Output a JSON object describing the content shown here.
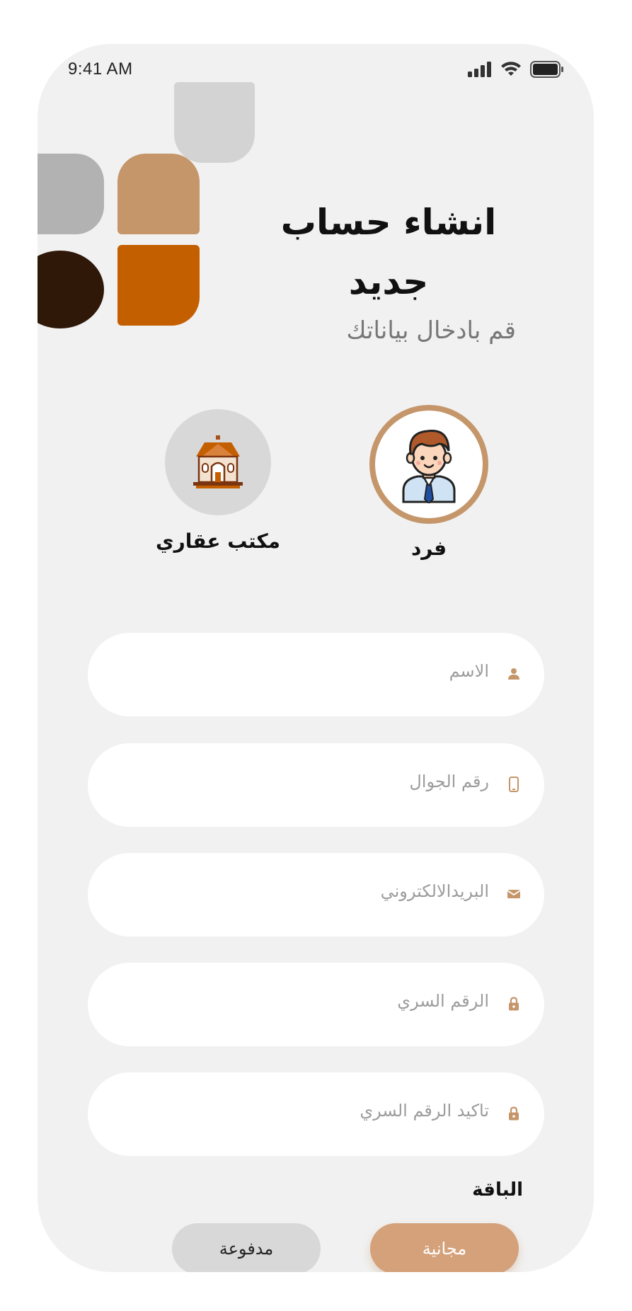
{
  "status_bar": {
    "time": "9:41 AM"
  },
  "header": {
    "title": "انشاء حساب جديد",
    "subtitle": "قم بادخال بياناتك"
  },
  "account_types": [
    {
      "label": "فرد",
      "icon": "man-avatar-icon",
      "selected": true
    },
    {
      "label": "مكتب عقاري",
      "icon": "house-icon",
      "selected": false
    }
  ],
  "form": {
    "name_placeholder": "الاسم",
    "phone_placeholder": "رقم الجوال",
    "email_placeholder": "البريدالالكتروني",
    "password_placeholder": "الرقم السري",
    "confirm_password_placeholder": "تاكيد الرقم السري"
  },
  "plan": {
    "title": "الباقة",
    "free_label": "مجانية",
    "paid_label": "مدفوعة",
    "selected": "free"
  },
  "colors": {
    "accent": "#c4966a",
    "orange": "#c45f00",
    "dark_brown": "#2f1808",
    "background": "#f1f1f1"
  }
}
